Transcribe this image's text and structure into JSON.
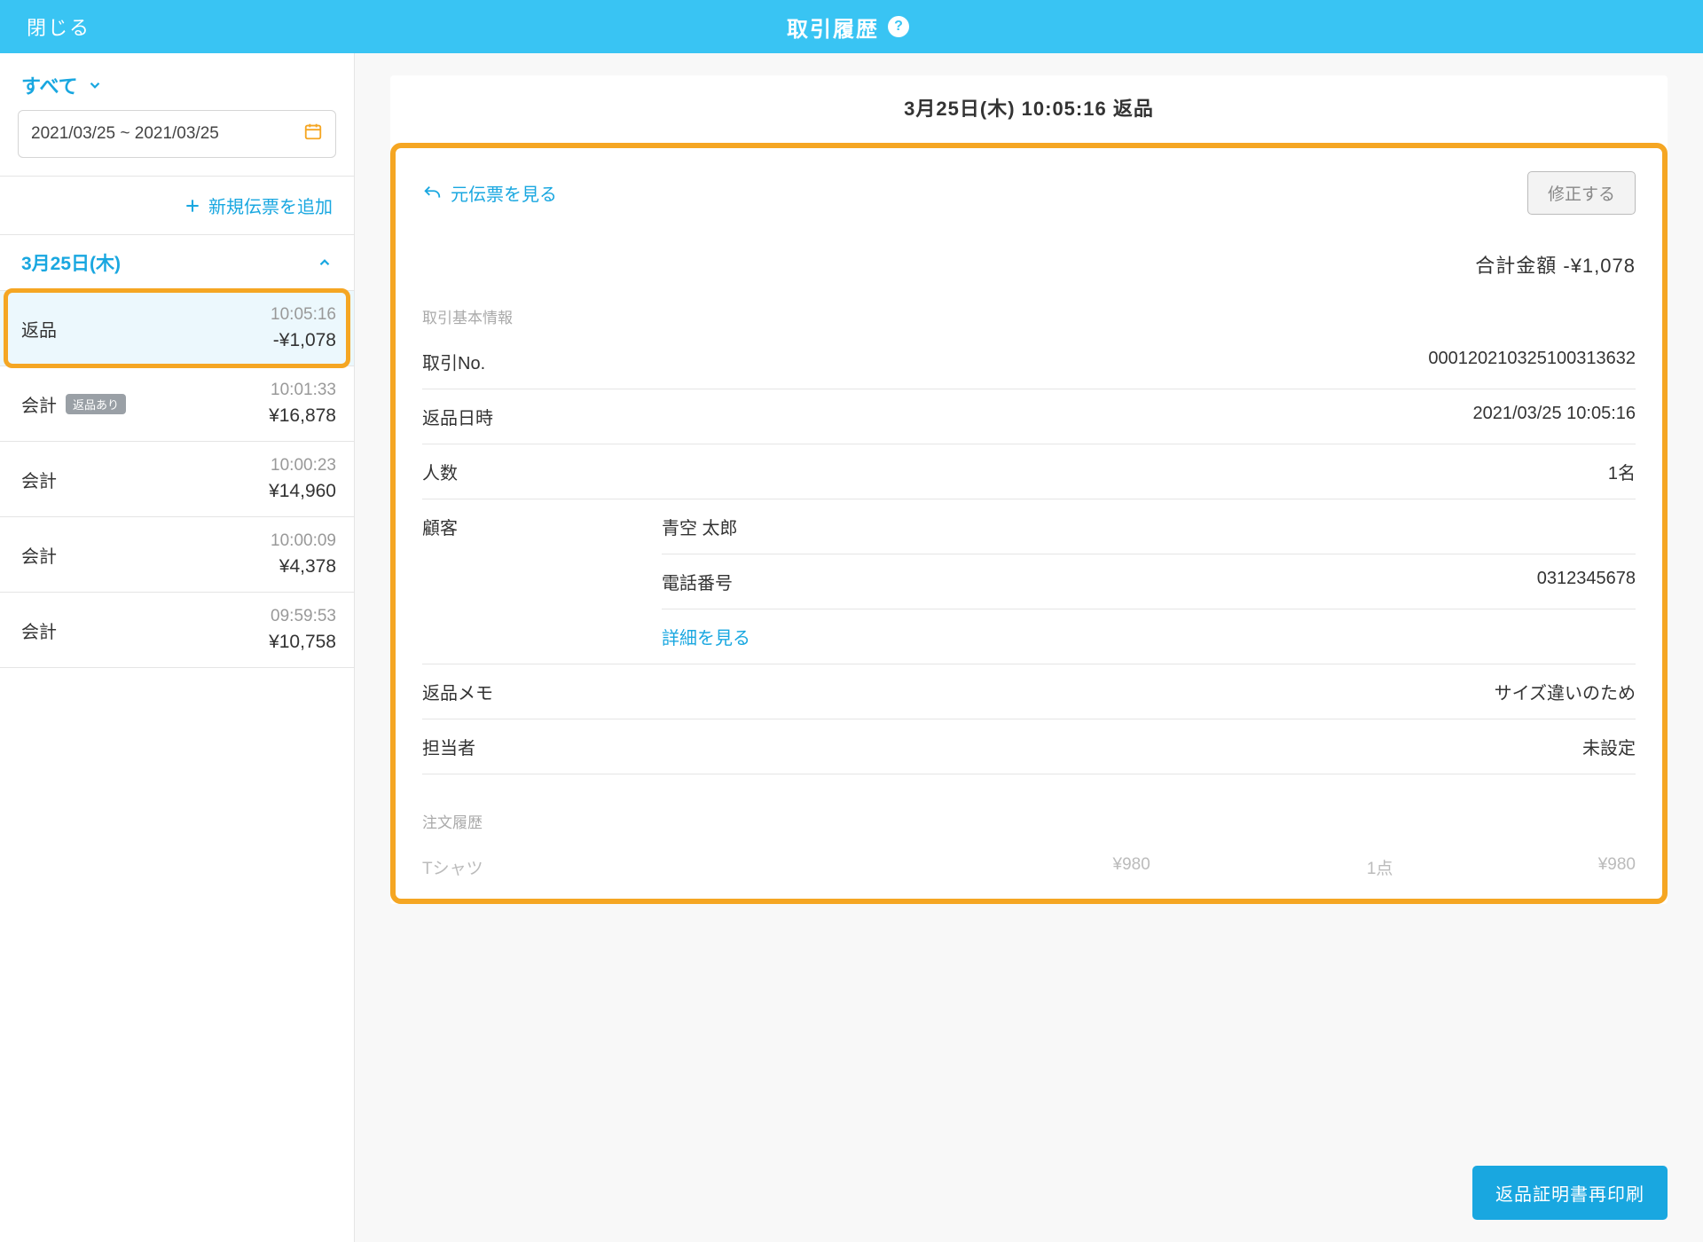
{
  "topbar": {
    "close": "閉じる",
    "title": "取引履歴"
  },
  "sidebar": {
    "filter_label": "すべて",
    "date_range": "2021/03/25 ~ 2021/03/25",
    "add_slip": "新規伝票を追加",
    "date_header": "3月25日(木)",
    "items": [
      {
        "type": "返品",
        "badge": "",
        "time": "10:05:16",
        "amount": "-¥1,078",
        "selected": true
      },
      {
        "type": "会計",
        "badge": "返品あり",
        "time": "10:01:33",
        "amount": "¥16,878",
        "selected": false
      },
      {
        "type": "会計",
        "badge": "",
        "time": "10:00:23",
        "amount": "¥14,960",
        "selected": false
      },
      {
        "type": "会計",
        "badge": "",
        "time": "10:00:09",
        "amount": "¥4,378",
        "selected": false
      },
      {
        "type": "会計",
        "badge": "",
        "time": "09:59:53",
        "amount": "¥10,758",
        "selected": false
      }
    ]
  },
  "detail": {
    "title": "3月25日(木) 10:05:16 返品",
    "link_original": "元伝票を見る",
    "btn_edit": "修正する",
    "total_label": "合計金額",
    "total_value": "-¥1,078",
    "section_basic": "取引基本情報",
    "rows": {
      "txn_no_label": "取引No.",
      "txn_no_value": "000120210325100313632",
      "return_dt_label": "返品日時",
      "return_dt_value": "2021/03/25 10:05:16",
      "people_label": "人数",
      "people_value": "1名",
      "customer_label": "顧客",
      "customer_value": "青空 太郎",
      "phone_label": "電話番号",
      "phone_value": "0312345678",
      "details_link": "詳細を見る",
      "memo_label": "返品メモ",
      "memo_value": "サイズ違いのため",
      "staff_label": "担当者",
      "staff_value": "未設定"
    },
    "section_order": "注文履歴",
    "order_line": {
      "name": "Tシャツ",
      "unit": "¥980",
      "qty": "1点",
      "sub": "¥980"
    },
    "btn_reprint": "返品証明書再印刷"
  }
}
